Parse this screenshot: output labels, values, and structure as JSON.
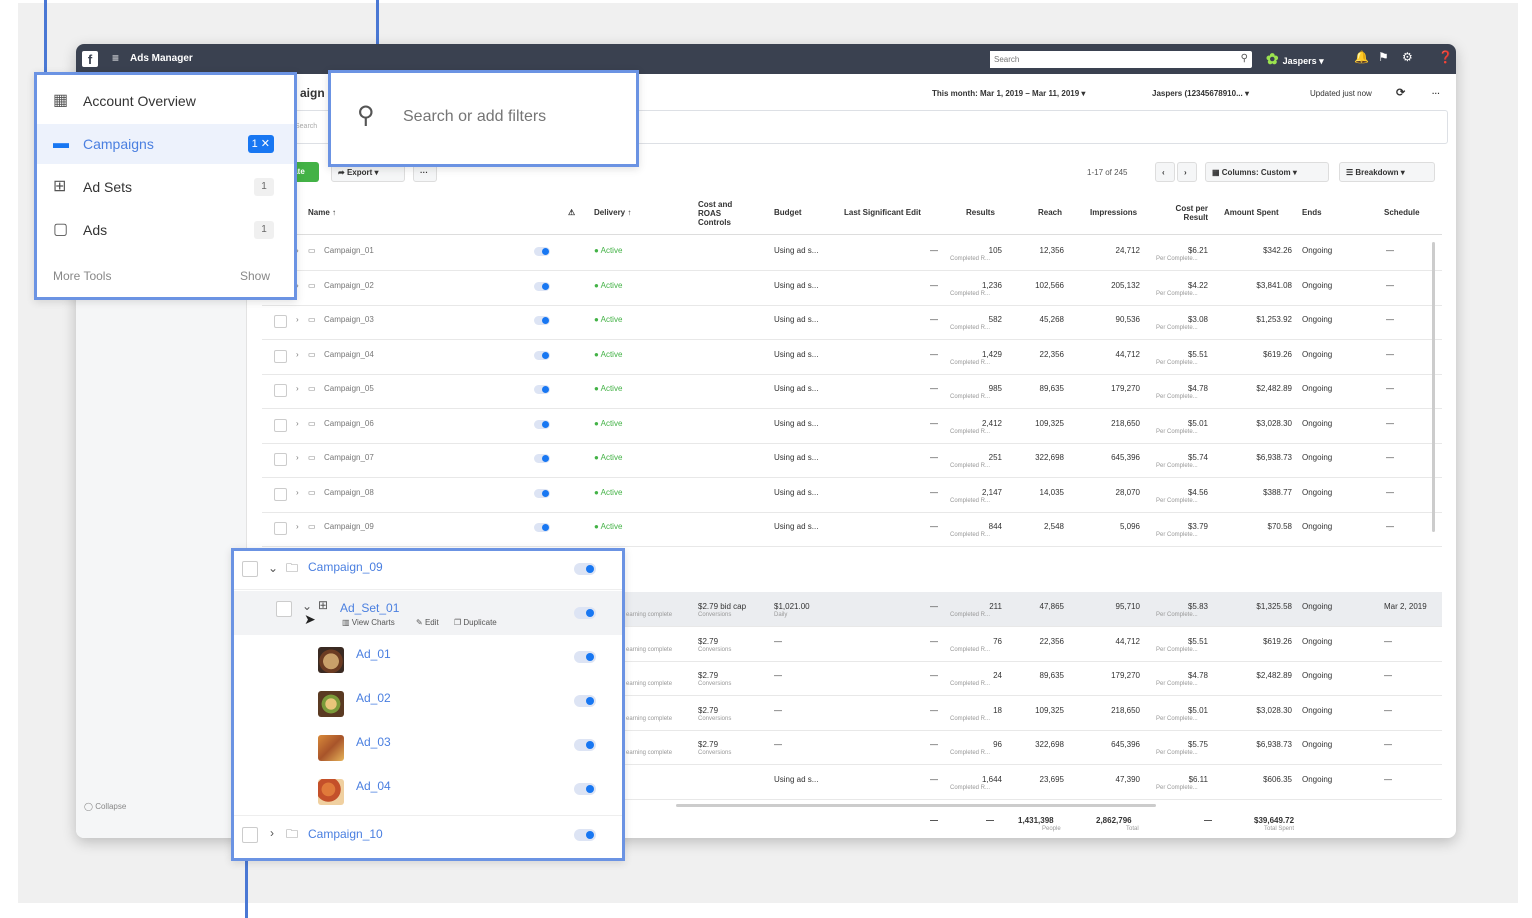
{
  "topbar": {
    "fb_logo": "f",
    "menu_icon": "≡",
    "app_title": "Ads Manager",
    "search_placeholder": "Search",
    "account_name": "Jaspers ▾"
  },
  "subheader": {
    "title_fragment": "aign",
    "date_range": "This month: Mar 1, 2019 – Mar 11, 2019 ▾",
    "account_id": "Jaspers (12345678910... ▾",
    "updated": "Updated just now"
  },
  "filter_placeholder": "Search",
  "toolbar": {
    "create_label": "ate",
    "export_label": "Export",
    "more_label": "···",
    "pagination": "1-17 of 245",
    "columns_label": "Columns: Custom ▾",
    "breakdown_label": "Breakdown ▾"
  },
  "table": {
    "headers": {
      "name": "Name ↑",
      "delivery": "Delivery ↑",
      "cost_roas": "Cost and ROAS Controls",
      "budget": "Budget",
      "last_edit": "Last Significant Edit",
      "results": "Results",
      "reach": "Reach",
      "impressions": "Impressions",
      "cost_per_result": "Cost per Result",
      "amount_spent": "Amount Spent",
      "ends": "Ends",
      "schedule": "Schedule"
    },
    "campaign_rows": [
      {
        "name": "Campaign_01",
        "delivery": "● Active",
        "budget": "Using ad s...",
        "edit": "—",
        "results": "105",
        "results_sub": "Completed R...",
        "reach": "12,356",
        "impressions": "24,712",
        "cpr": "$6.21",
        "cpr_sub": "Per Complete...",
        "spent": "$342.26",
        "ends": "Ongoing",
        "schedule": "—"
      },
      {
        "name": "Campaign_02",
        "delivery": "● Active",
        "budget": "Using ad s...",
        "edit": "—",
        "results": "1,236",
        "results_sub": "Completed R...",
        "reach": "102,566",
        "impressions": "205,132",
        "cpr": "$4.22",
        "cpr_sub": "Per Complete...",
        "spent": "$3,841.08",
        "ends": "Ongoing",
        "schedule": "—"
      },
      {
        "name": "Campaign_03",
        "delivery": "● Active",
        "budget": "Using ad s...",
        "edit": "—",
        "results": "582",
        "results_sub": "Completed R...",
        "reach": "45,268",
        "impressions": "90,536",
        "cpr": "$3.08",
        "cpr_sub": "Per Complete...",
        "spent": "$1,253.92",
        "ends": "Ongoing",
        "schedule": "—"
      },
      {
        "name": "Campaign_04",
        "delivery": "● Active",
        "budget": "Using ad s...",
        "edit": "—",
        "results": "1,429",
        "results_sub": "Completed R...",
        "reach": "22,356",
        "impressions": "44,712",
        "cpr": "$5.51",
        "cpr_sub": "Per Complete...",
        "spent": "$619.26",
        "ends": "Ongoing",
        "schedule": "—"
      },
      {
        "name": "Campaign_05",
        "delivery": "● Active",
        "budget": "Using ad s...",
        "edit": "—",
        "results": "985",
        "results_sub": "Completed R...",
        "reach": "89,635",
        "impressions": "179,270",
        "cpr": "$4.78",
        "cpr_sub": "Per Complete...",
        "spent": "$2,482.89",
        "ends": "Ongoing",
        "schedule": "—"
      },
      {
        "name": "Campaign_06",
        "delivery": "● Active",
        "budget": "Using ad s...",
        "edit": "—",
        "results": "2,412",
        "results_sub": "Completed R...",
        "reach": "109,325",
        "impressions": "218,650",
        "cpr": "$5.01",
        "cpr_sub": "Per Complete...",
        "spent": "$3,028.30",
        "ends": "Ongoing",
        "schedule": "—"
      },
      {
        "name": "Campaign_07",
        "delivery": "● Active",
        "budget": "Using ad s...",
        "edit": "—",
        "results": "251",
        "results_sub": "Completed R...",
        "reach": "322,698",
        "impressions": "645,396",
        "cpr": "$5.74",
        "cpr_sub": "Per Complete...",
        "spent": "$6,938.73",
        "ends": "Ongoing",
        "schedule": "—"
      },
      {
        "name": "Campaign_08",
        "delivery": "● Active",
        "budget": "Using ad s...",
        "edit": "—",
        "results": "2,147",
        "results_sub": "Completed R...",
        "reach": "14,035",
        "impressions": "28,070",
        "cpr": "$4.56",
        "cpr_sub": "Per Complete...",
        "spent": "$388.77",
        "ends": "Ongoing",
        "schedule": "—"
      },
      {
        "name": "Campaign_09",
        "delivery": "● Active",
        "budget": "Using ad s...",
        "edit": "—",
        "results": "844",
        "results_sub": "Completed R...",
        "reach": "2,548",
        "impressions": "5,096",
        "cpr": "$3.79",
        "cpr_sub": "Per Complete...",
        "spent": "$70.58",
        "ends": "Ongoing",
        "schedule": "—"
      }
    ],
    "expanded_rows": [
      {
        "delivery_sub": "earning complete",
        "cost": "$2.79 bid cap",
        "cost_sub": "Conversions",
        "budget": "$1,021.00",
        "budget_sub": "Daily",
        "edit": "—",
        "results": "211",
        "results_sub": "Completed R...",
        "reach": "47,865",
        "impressions": "95,710",
        "cpr": "$5.83",
        "cpr_sub": "Per Complete...",
        "spent": "$1,325.58",
        "ends": "Ongoing",
        "schedule": "Mar 2, 2019"
      },
      {
        "delivery_sub": "earning complete",
        "cost": "$2.79",
        "cost_sub": "Conversions",
        "budget": "—",
        "budget_sub": "",
        "edit": "—",
        "results": "76",
        "results_sub": "Completed R...",
        "reach": "22,356",
        "impressions": "44,712",
        "cpr": "$5.51",
        "cpr_sub": "Per Complete...",
        "spent": "$619.26",
        "ends": "Ongoing",
        "schedule": "—"
      },
      {
        "delivery_sub": "earning complete",
        "cost": "$2.79",
        "cost_sub": "Conversions",
        "budget": "—",
        "budget_sub": "",
        "edit": "—",
        "results": "24",
        "results_sub": "Completed R...",
        "reach": "89,635",
        "impressions": "179,270",
        "cpr": "$4.78",
        "cpr_sub": "Per Complete...",
        "spent": "$2,482.89",
        "ends": "Ongoing",
        "schedule": "—"
      },
      {
        "delivery_sub": "earning complete",
        "cost": "$2.79",
        "cost_sub": "Conversions",
        "budget": "—",
        "budget_sub": "",
        "edit": "—",
        "results": "18",
        "results_sub": "Completed R...",
        "reach": "109,325",
        "impressions": "218,650",
        "cpr": "$5.01",
        "cpr_sub": "Per Complete...",
        "spent": "$3,028.30",
        "ends": "Ongoing",
        "schedule": "—"
      },
      {
        "delivery_sub": "earning complete",
        "cost": "$2.79",
        "cost_sub": "Conversions",
        "budget": "—",
        "budget_sub": "",
        "edit": "—",
        "results": "96",
        "results_sub": "Completed R...",
        "reach": "322,698",
        "impressions": "645,396",
        "cpr": "$5.75",
        "cpr_sub": "Per Complete...",
        "spent": "$6,938.73",
        "ends": "Ongoing",
        "schedule": "—"
      },
      {
        "delivery_sub": "",
        "cost": "",
        "cost_sub": "",
        "budget": "Using ad s...",
        "budget_sub": "",
        "edit": "—",
        "results": "1,644",
        "results_sub": "Completed R...",
        "reach": "23,695",
        "impressions": "47,390",
        "cpr": "$6.11",
        "cpr_sub": "Per Complete...",
        "spent": "$606.35",
        "ends": "Ongoing",
        "schedule": "—"
      }
    ],
    "totals": {
      "edit": "—",
      "results": "—",
      "reach": "1,431,398",
      "reach_sub": "People",
      "impressions": "2,862,796",
      "impressions_sub": "Total",
      "cpr": "—",
      "spent": "$39,649.72",
      "spent_sub": "Total Spent"
    }
  },
  "collapse_label": "Collapse",
  "nav_callout": {
    "items": [
      {
        "label": "Account Overview",
        "badge": ""
      },
      {
        "label": "Campaigns",
        "badge": "1 ✕"
      },
      {
        "label": "Ad Sets",
        "badge": "1"
      },
      {
        "label": "Ads",
        "badge": "1"
      }
    ],
    "more_tools": "More Tools",
    "show": "Show"
  },
  "search_callout": {
    "placeholder": "Search or add filters"
  },
  "tree_callout": {
    "campaign_09": "Campaign_09",
    "ad_set": "Ad_Set_01",
    "view_charts": "View Charts",
    "edit": "Edit",
    "duplicate": "Duplicate",
    "ads": [
      "Ad_01",
      "Ad_02",
      "Ad_03",
      "Ad_04"
    ],
    "campaign_10": "Campaign_10"
  },
  "colors": {
    "accent": "#1877f2",
    "callout_border": "#6b93e3",
    "active_green": "#43b246",
    "topbar": "#3a4150"
  }
}
